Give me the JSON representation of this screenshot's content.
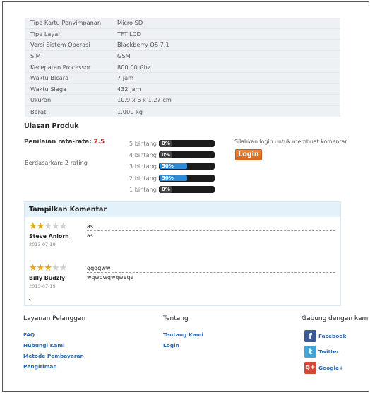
{
  "specs": [
    {
      "key": "Tipe Kartu Penyimpanan",
      "value": "Micro SD"
    },
    {
      "key": "Tipe Layar",
      "value": "TFT LCD"
    },
    {
      "key": "Versi Sistem Operasi",
      "value": "Blackberry OS 7.1"
    },
    {
      "key": "SIM",
      "value": "GSM"
    },
    {
      "key": "Kecepatan Processor",
      "value": "800.00 Ghz"
    },
    {
      "key": "Waktu Bicara",
      "value": "7 jam"
    },
    {
      "key": "Waktu Siaga",
      "value": "432 jam"
    },
    {
      "key": "Ukuran",
      "value": "10.9 x 6 x 1.27 cm"
    },
    {
      "key": "Berat",
      "value": "1.000 kg"
    }
  ],
  "reviews": {
    "title": "Ulasan Produk",
    "avg_label": "Penilaian rata-rata:",
    "avg_value": "2.5",
    "based_on": "Berdasarkan: 2 rating",
    "bars": [
      {
        "label": "5 bintang",
        "pct": "0%",
        "fraction": 0
      },
      {
        "label": "4 bintang",
        "pct": "0%",
        "fraction": 0
      },
      {
        "label": "3 bintang",
        "pct": "50%",
        "fraction": 0.5
      },
      {
        "label": "2 bintang",
        "pct": "50%",
        "fraction": 0.5
      },
      {
        "label": "1 bintang",
        "pct": "0%",
        "fraction": 0
      }
    ],
    "login_message": "Silahkan login untuk membuat komentar",
    "login_button": "Login"
  },
  "comments": {
    "title": "Tampilkan Komentar",
    "items": [
      {
        "stars": 2,
        "author": "Steve Anlorn",
        "date": "2013-07-19",
        "title": "as",
        "body": "as"
      },
      {
        "stars": 3,
        "author": "Billy Budzly",
        "date": "2013-07-19",
        "title": "qqqqww",
        "body": "wqwqwqwqweqe"
      }
    ],
    "page": "1"
  },
  "footer": {
    "col1": {
      "title": "Layanan Pelanggan",
      "links": [
        "FAQ",
        "Hubungi Kami",
        "Metode Pembayaran",
        "Pengiriman"
      ]
    },
    "col2": {
      "title": "Tentang",
      "links": [
        "Tentang Kami",
        "Login"
      ]
    },
    "col3": {
      "title": "Gabung dengan kami di",
      "social": [
        {
          "label": "Facebook",
          "icon": "f",
          "color": "#3b5998"
        },
        {
          "label": "Twitter",
          "icon": "t",
          "color": "#41a6d9"
        },
        {
          "label": "Google+",
          "icon": "g+",
          "color": "#d34836"
        }
      ]
    }
  }
}
